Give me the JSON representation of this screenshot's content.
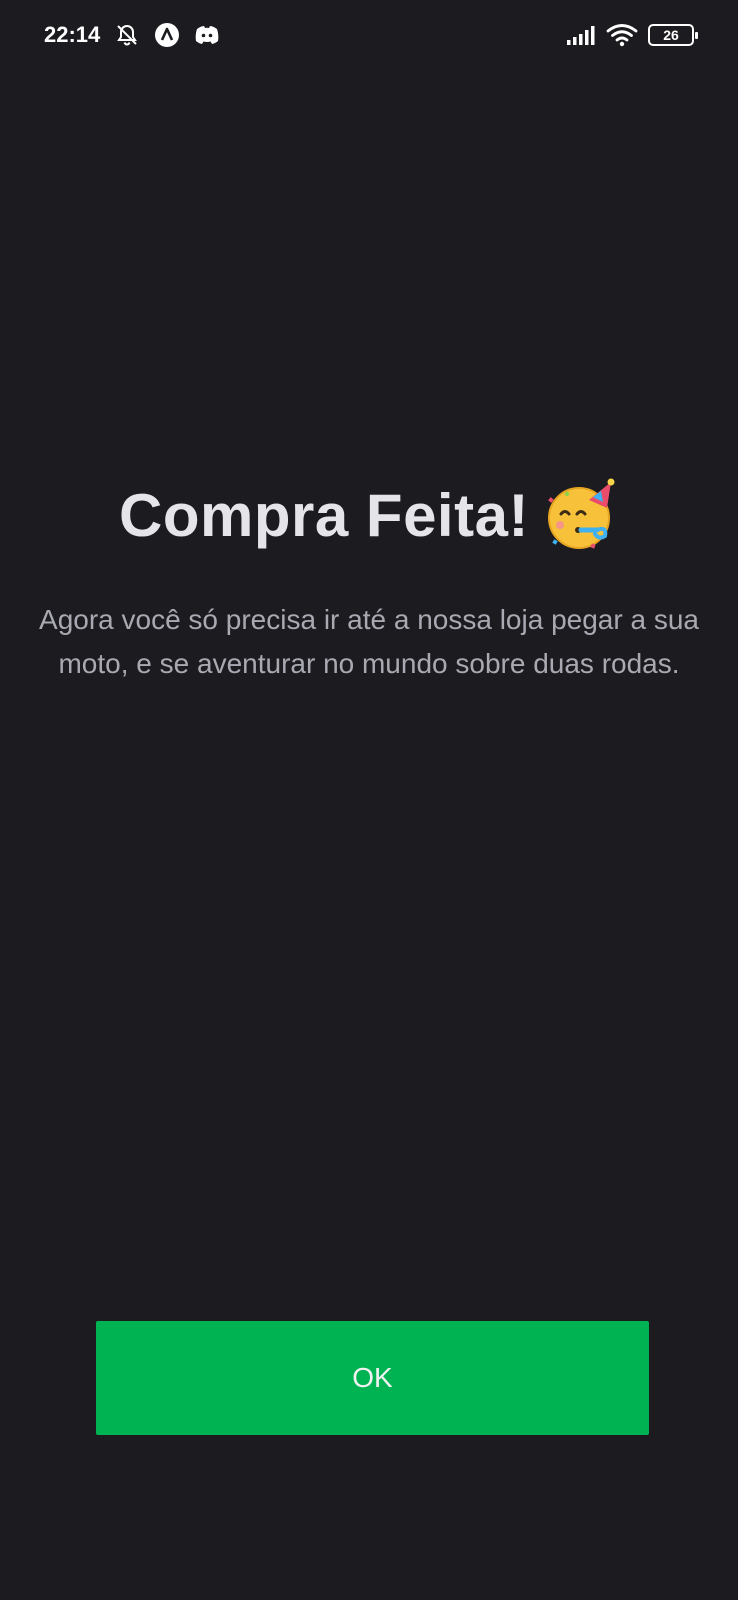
{
  "status_bar": {
    "time": "22:14",
    "battery_level": "26",
    "left_icons": [
      "bell-muted-icon",
      "app-a-icon",
      "discord-icon"
    ],
    "right_icons": [
      "signal-icon",
      "wifi-icon",
      "battery-icon"
    ]
  },
  "main": {
    "title": "Compra Feita!",
    "title_emoji": "partying-face-icon",
    "message": "Agora você só precisa ir até a nossa loja pegar a sua moto, e se aventurar no mundo sobre duas rodas."
  },
  "actions": {
    "ok_label": "OK"
  },
  "colors": {
    "background": "#1c1b20",
    "primary_button": "#00b352",
    "title_text": "#e4e4e9",
    "body_text": "#a9a9b2"
  }
}
